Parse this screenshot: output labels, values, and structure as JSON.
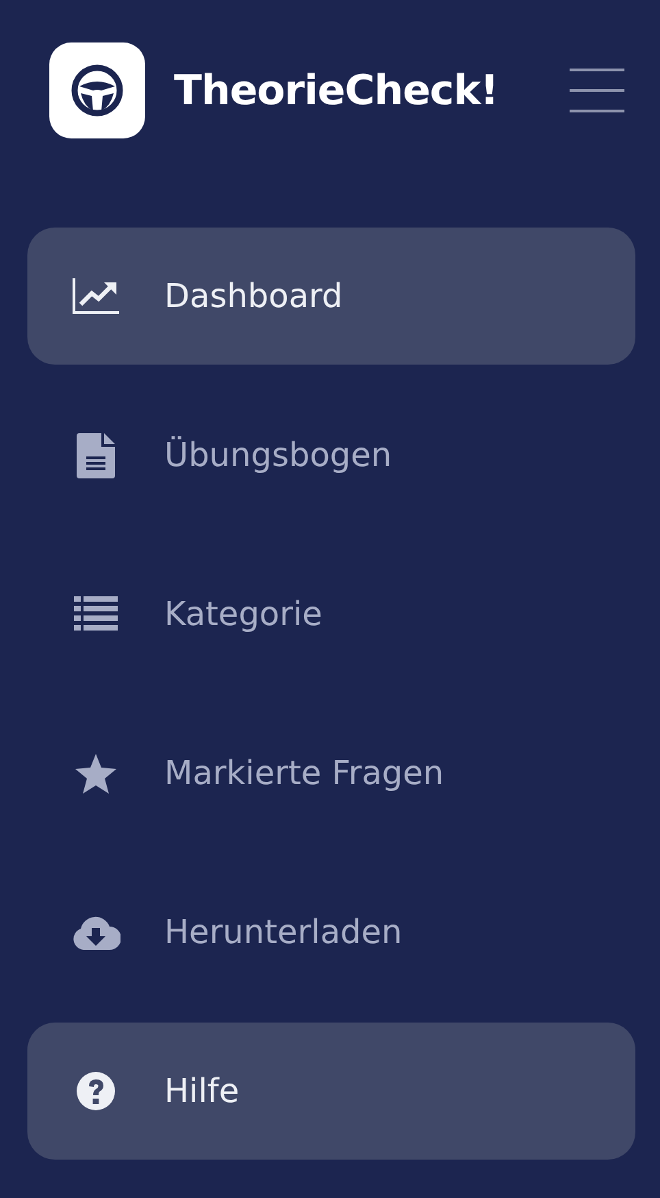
{
  "app": {
    "title": "TheorieCheck!"
  },
  "menu": [
    {
      "label": "Dashboard",
      "selected": true
    },
    {
      "label": "Übungsbogen",
      "selected": false
    },
    {
      "label": "Kategorie",
      "selected": false
    },
    {
      "label": "Markierte Fragen",
      "selected": false
    },
    {
      "label": "Herunterladen",
      "selected": false
    },
    {
      "label": "Hilfe",
      "selected": true
    }
  ]
}
